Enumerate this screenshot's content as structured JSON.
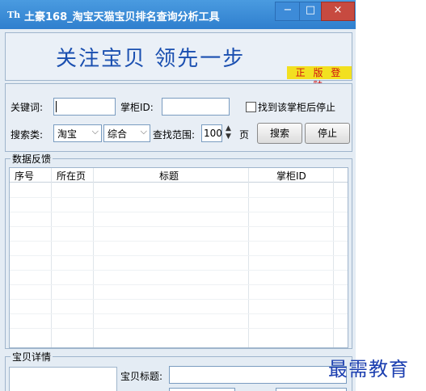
{
  "window": {
    "title": "土豪168_淘宝天猫宝贝排名查询分析工具",
    "icon_text": "Th",
    "controls": {
      "minimize": "−",
      "maximize": "□",
      "close": "×"
    }
  },
  "banner": {
    "slogan": "关注宝贝  领先一步",
    "login_label": "正 版 登 陆"
  },
  "search_form": {
    "keyword_label": "关键词:",
    "keyword_value": "",
    "shop_id_label": "掌柜ID:",
    "shop_id_value": "",
    "stop_checkbox_label": "找到该掌柜后停止",
    "stop_checked": false,
    "search_type_label": "搜索类:",
    "platform_selected": "淘宝",
    "sort_selected": "综合",
    "range_label": "查找范围:",
    "range_value": "100",
    "page_unit": "页",
    "search_button": "搜索",
    "stop_button": "停止"
  },
  "feedback": {
    "group_title": "数据反馈",
    "columns": [
      "序号",
      "所在页",
      "标题",
      "掌柜ID"
    ]
  },
  "detail": {
    "group_title": "宝贝详情",
    "title_label": "宝贝标题:"
  },
  "watermark": "最需教育",
  "colors": {
    "titlebar": "#2f7fce",
    "slogan": "#1a4fb0",
    "login_bg": "#f2e020",
    "login_text": "#d01010",
    "watermark": "#1c3fb0"
  }
}
